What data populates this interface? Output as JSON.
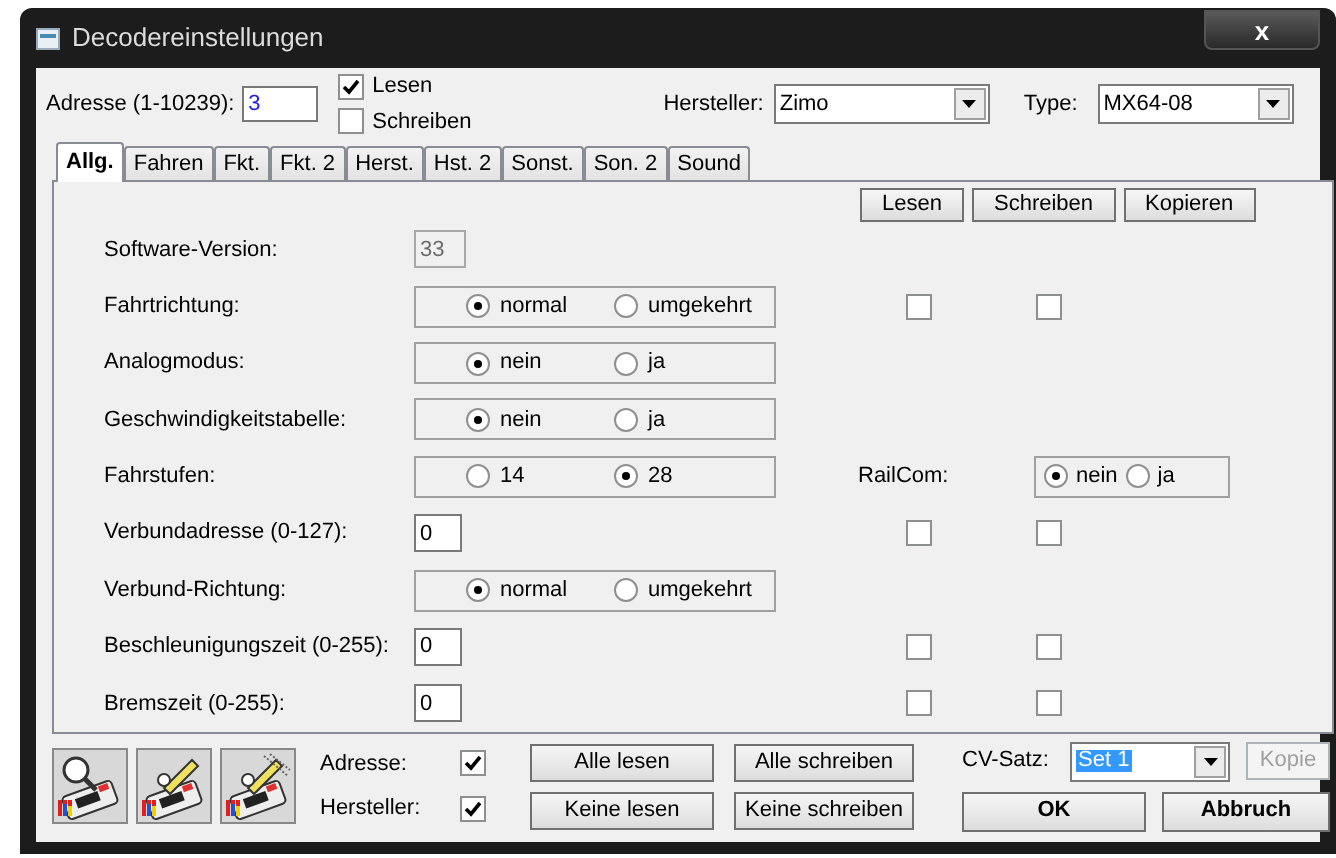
{
  "window": {
    "title": "Decodereinstellungen",
    "close": "x"
  },
  "address": {
    "label": "Adresse (1-10239):",
    "value": "3"
  },
  "mode_checks": [
    {
      "label": "Lesen",
      "checked": true
    },
    {
      "label": "Schreiben",
      "checked": false
    }
  ],
  "manufacturer": {
    "label": "Hersteller:",
    "value": "Zimo"
  },
  "type": {
    "label": "Type:",
    "value": "MX64-08"
  },
  "tabs": [
    {
      "label": "Allg.",
      "selected": true
    },
    {
      "label": "Fahren",
      "selected": false
    },
    {
      "label": "Fkt.",
      "selected": false
    },
    {
      "label": "Fkt. 2",
      "selected": false
    },
    {
      "label": "Herst.",
      "selected": false
    },
    {
      "label": "Hst. 2",
      "selected": false
    },
    {
      "label": "Sonst.",
      "selected": false
    },
    {
      "label": "Son. 2",
      "selected": false
    },
    {
      "label": "Sound",
      "selected": false
    }
  ],
  "panel_buttons": [
    "Lesen",
    "Schreiben",
    "Kopieren"
  ],
  "rows": [
    {
      "kind": "readonly",
      "label": "Software-Version:",
      "value": "33"
    },
    {
      "kind": "radio",
      "label": "Fahrtrichtung:",
      "options": [
        {
          "label": "normal",
          "selected": true
        },
        {
          "label": "umgekehrt",
          "selected": false
        }
      ],
      "checks": [
        {
          "checked": false
        },
        {
          "checked": false
        }
      ]
    },
    {
      "kind": "radio",
      "label": "Analogmodus:",
      "options": [
        {
          "label": "nein",
          "selected": true
        },
        {
          "label": "ja",
          "selected": false
        }
      ]
    },
    {
      "kind": "radio",
      "label": "Geschwindigkeitstabelle:",
      "options": [
        {
          "label": "nein",
          "selected": true
        },
        {
          "label": "ja",
          "selected": false
        }
      ]
    },
    {
      "kind": "radio",
      "label": "Fahrstufen:",
      "options": [
        {
          "label": "14",
          "selected": false
        },
        {
          "label": "28",
          "selected": true
        }
      ],
      "railcom": {
        "label": "RailCom:",
        "options": [
          {
            "label": "nein",
            "selected": true
          },
          {
            "label": "ja",
            "selected": false
          }
        ]
      }
    },
    {
      "kind": "input",
      "label": "Verbundadresse (0-127):",
      "value": "0",
      "checks": [
        {
          "checked": false
        },
        {
          "checked": false
        }
      ]
    },
    {
      "kind": "radio",
      "label": "Verbund-Richtung:",
      "options": [
        {
          "label": "normal",
          "selected": true
        },
        {
          "label": "umgekehrt",
          "selected": false
        }
      ]
    },
    {
      "kind": "input",
      "label": "Beschleunigungszeit (0-255):",
      "value": "0",
      "checks": [
        {
          "checked": false
        },
        {
          "checked": false
        }
      ]
    },
    {
      "kind": "input",
      "label": "Bremszeit (0-255):",
      "value": "0",
      "checks": [
        {
          "checked": false
        },
        {
          "checked": false
        }
      ]
    }
  ],
  "bottom": {
    "checks": [
      {
        "label": "Adresse:",
        "checked": true
      },
      {
        "label": "Hersteller:",
        "checked": true
      }
    ],
    "buttons": [
      [
        "Alle lesen",
        "Alle schreiben"
      ],
      [
        "Keine lesen",
        "Keine schreiben"
      ]
    ],
    "cv_set": {
      "label": "CV-Satz:",
      "value": "Set 1"
    },
    "copy": {
      "label": "Kopie",
      "disabled": true
    },
    "ok": "OK",
    "cancel": "Abbruch"
  }
}
